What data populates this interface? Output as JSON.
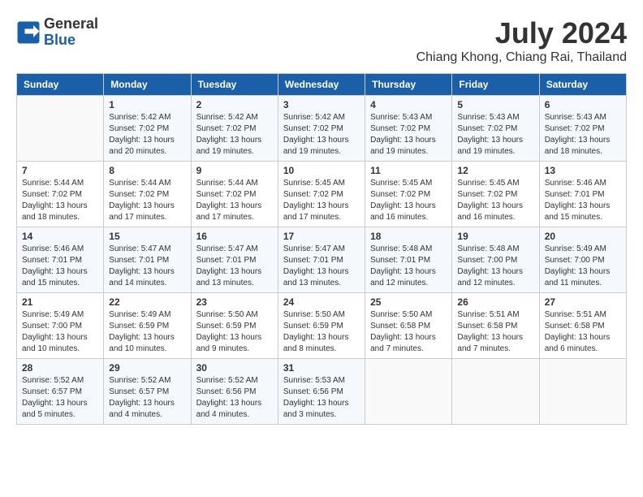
{
  "header": {
    "logo_line1": "General",
    "logo_line2": "Blue",
    "month": "July 2024",
    "location": "Chiang Khong, Chiang Rai, Thailand"
  },
  "weekdays": [
    "Sunday",
    "Monday",
    "Tuesday",
    "Wednesday",
    "Thursday",
    "Friday",
    "Saturday"
  ],
  "weeks": [
    [
      {
        "day": "",
        "sunrise": "",
        "sunset": "",
        "daylight": ""
      },
      {
        "day": "1",
        "sunrise": "Sunrise: 5:42 AM",
        "sunset": "Sunset: 7:02 PM",
        "daylight": "Daylight: 13 hours and 20 minutes."
      },
      {
        "day": "2",
        "sunrise": "Sunrise: 5:42 AM",
        "sunset": "Sunset: 7:02 PM",
        "daylight": "Daylight: 13 hours and 19 minutes."
      },
      {
        "day": "3",
        "sunrise": "Sunrise: 5:42 AM",
        "sunset": "Sunset: 7:02 PM",
        "daylight": "Daylight: 13 hours and 19 minutes."
      },
      {
        "day": "4",
        "sunrise": "Sunrise: 5:43 AM",
        "sunset": "Sunset: 7:02 PM",
        "daylight": "Daylight: 13 hours and 19 minutes."
      },
      {
        "day": "5",
        "sunrise": "Sunrise: 5:43 AM",
        "sunset": "Sunset: 7:02 PM",
        "daylight": "Daylight: 13 hours and 19 minutes."
      },
      {
        "day": "6",
        "sunrise": "Sunrise: 5:43 AM",
        "sunset": "Sunset: 7:02 PM",
        "daylight": "Daylight: 13 hours and 18 minutes."
      }
    ],
    [
      {
        "day": "7",
        "sunrise": "Sunrise: 5:44 AM",
        "sunset": "Sunset: 7:02 PM",
        "daylight": "Daylight: 13 hours and 18 minutes."
      },
      {
        "day": "8",
        "sunrise": "Sunrise: 5:44 AM",
        "sunset": "Sunset: 7:02 PM",
        "daylight": "Daylight: 13 hours and 17 minutes."
      },
      {
        "day": "9",
        "sunrise": "Sunrise: 5:44 AM",
        "sunset": "Sunset: 7:02 PM",
        "daylight": "Daylight: 13 hours and 17 minutes."
      },
      {
        "day": "10",
        "sunrise": "Sunrise: 5:45 AM",
        "sunset": "Sunset: 7:02 PM",
        "daylight": "Daylight: 13 hours and 17 minutes."
      },
      {
        "day": "11",
        "sunrise": "Sunrise: 5:45 AM",
        "sunset": "Sunset: 7:02 PM",
        "daylight": "Daylight: 13 hours and 16 minutes."
      },
      {
        "day": "12",
        "sunrise": "Sunrise: 5:45 AM",
        "sunset": "Sunset: 7:02 PM",
        "daylight": "Daylight: 13 hours and 16 minutes."
      },
      {
        "day": "13",
        "sunrise": "Sunrise: 5:46 AM",
        "sunset": "Sunset: 7:01 PM",
        "daylight": "Daylight: 13 hours and 15 minutes."
      }
    ],
    [
      {
        "day": "14",
        "sunrise": "Sunrise: 5:46 AM",
        "sunset": "Sunset: 7:01 PM",
        "daylight": "Daylight: 13 hours and 15 minutes."
      },
      {
        "day": "15",
        "sunrise": "Sunrise: 5:47 AM",
        "sunset": "Sunset: 7:01 PM",
        "daylight": "Daylight: 13 hours and 14 minutes."
      },
      {
        "day": "16",
        "sunrise": "Sunrise: 5:47 AM",
        "sunset": "Sunset: 7:01 PM",
        "daylight": "Daylight: 13 hours and 13 minutes."
      },
      {
        "day": "17",
        "sunrise": "Sunrise: 5:47 AM",
        "sunset": "Sunset: 7:01 PM",
        "daylight": "Daylight: 13 hours and 13 minutes."
      },
      {
        "day": "18",
        "sunrise": "Sunrise: 5:48 AM",
        "sunset": "Sunset: 7:01 PM",
        "daylight": "Daylight: 13 hours and 12 minutes."
      },
      {
        "day": "19",
        "sunrise": "Sunrise: 5:48 AM",
        "sunset": "Sunset: 7:00 PM",
        "daylight": "Daylight: 13 hours and 12 minutes."
      },
      {
        "day": "20",
        "sunrise": "Sunrise: 5:49 AM",
        "sunset": "Sunset: 7:00 PM",
        "daylight": "Daylight: 13 hours and 11 minutes."
      }
    ],
    [
      {
        "day": "21",
        "sunrise": "Sunrise: 5:49 AM",
        "sunset": "Sunset: 7:00 PM",
        "daylight": "Daylight: 13 hours and 10 minutes."
      },
      {
        "day": "22",
        "sunrise": "Sunrise: 5:49 AM",
        "sunset": "Sunset: 6:59 PM",
        "daylight": "Daylight: 13 hours and 10 minutes."
      },
      {
        "day": "23",
        "sunrise": "Sunrise: 5:50 AM",
        "sunset": "Sunset: 6:59 PM",
        "daylight": "Daylight: 13 hours and 9 minutes."
      },
      {
        "day": "24",
        "sunrise": "Sunrise: 5:50 AM",
        "sunset": "Sunset: 6:59 PM",
        "daylight": "Daylight: 13 hours and 8 minutes."
      },
      {
        "day": "25",
        "sunrise": "Sunrise: 5:50 AM",
        "sunset": "Sunset: 6:58 PM",
        "daylight": "Daylight: 13 hours and 7 minutes."
      },
      {
        "day": "26",
        "sunrise": "Sunrise: 5:51 AM",
        "sunset": "Sunset: 6:58 PM",
        "daylight": "Daylight: 13 hours and 7 minutes."
      },
      {
        "day": "27",
        "sunrise": "Sunrise: 5:51 AM",
        "sunset": "Sunset: 6:58 PM",
        "daylight": "Daylight: 13 hours and 6 minutes."
      }
    ],
    [
      {
        "day": "28",
        "sunrise": "Sunrise: 5:52 AM",
        "sunset": "Sunset: 6:57 PM",
        "daylight": "Daylight: 13 hours and 5 minutes."
      },
      {
        "day": "29",
        "sunrise": "Sunrise: 5:52 AM",
        "sunset": "Sunset: 6:57 PM",
        "daylight": "Daylight: 13 hours and 4 minutes."
      },
      {
        "day": "30",
        "sunrise": "Sunrise: 5:52 AM",
        "sunset": "Sunset: 6:56 PM",
        "daylight": "Daylight: 13 hours and 4 minutes."
      },
      {
        "day": "31",
        "sunrise": "Sunrise: 5:53 AM",
        "sunset": "Sunset: 6:56 PM",
        "daylight": "Daylight: 13 hours and 3 minutes."
      },
      {
        "day": "",
        "sunrise": "",
        "sunset": "",
        "daylight": ""
      },
      {
        "day": "",
        "sunrise": "",
        "sunset": "",
        "daylight": ""
      },
      {
        "day": "",
        "sunrise": "",
        "sunset": "",
        "daylight": ""
      }
    ]
  ]
}
